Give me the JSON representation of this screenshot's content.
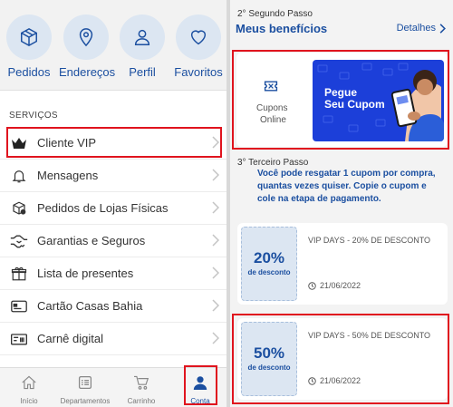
{
  "shortcuts": [
    {
      "label": "Pedidos",
      "icon": "box-icon"
    },
    {
      "label": "Endereços",
      "icon": "location-pin-icon"
    },
    {
      "label": "Perfil",
      "icon": "user-icon"
    },
    {
      "label": "Favoritos",
      "icon": "heart-icon"
    }
  ],
  "services": {
    "title": "SERVIÇOS",
    "items": [
      {
        "label": "Cliente VIP",
        "icon": "crown-icon"
      },
      {
        "label": "Mensagens",
        "icon": "bell-icon"
      },
      {
        "label": "Pedidos de Lojas Físicas",
        "icon": "store-box-icon"
      },
      {
        "label": "Garantias e Seguros",
        "icon": "handshake-icon"
      },
      {
        "label": "Lista de presentes",
        "icon": "gift-icon"
      },
      {
        "label": "Cartão Casas Bahia",
        "icon": "card-icon"
      },
      {
        "label": "Carnê digital",
        "icon": "bill-icon"
      }
    ]
  },
  "bottom_nav": {
    "items": [
      {
        "label": "Início",
        "icon": "home-icon"
      },
      {
        "label": "Departamentos",
        "icon": "list-icon"
      },
      {
        "label": "Carrinho",
        "icon": "cart-icon"
      },
      {
        "label": "Conta",
        "icon": "account-icon",
        "active": true
      }
    ]
  },
  "benefits": {
    "step2": "2° Segundo Passo",
    "title": "Meus benefícios",
    "details_link": "Detalhes",
    "coupons_label_1": "Cupons",
    "coupons_label_2": "Online",
    "banner_line1": "Pegue",
    "banner_line2": "Seu Cupom",
    "step3": "3° Terceiro Passo",
    "info_text": "Você pode resgatar 1 cupom por compra, quantas vezes quiser. Copie o cupom e cole na etapa de pagamento."
  },
  "coupons": [
    {
      "percent": "20%",
      "discount_label": "de desconto",
      "title": "VIP DAYS - 20% DE DESCONTO",
      "date": "21/06/2022"
    },
    {
      "percent": "50%",
      "discount_label": "de desconto",
      "title": "VIP DAYS - 50% DE DESCONTO",
      "date": "21/06/2022"
    }
  ],
  "colors": {
    "brand_blue": "#1b4fa0",
    "highlight_red": "#e0141e",
    "banner_blue": "#1c3fd9",
    "chip_bg": "#dce6f2"
  }
}
